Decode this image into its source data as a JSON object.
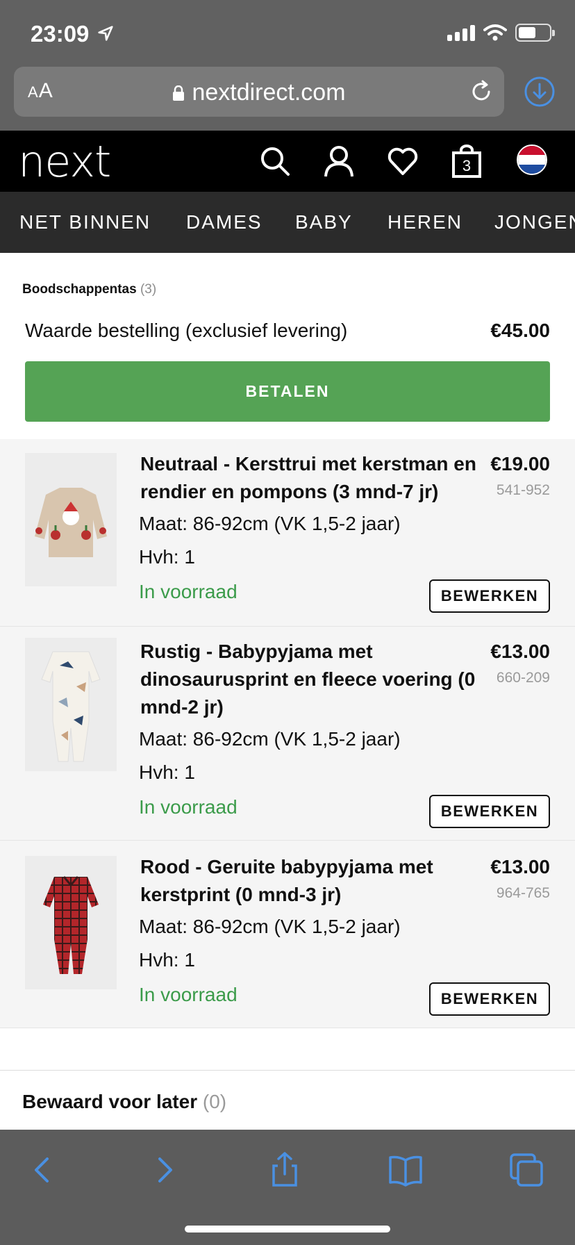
{
  "status_bar": {
    "time": "23:09"
  },
  "browser": {
    "text_size_label_small": "A",
    "text_size_label_large": "A",
    "url": "nextdirect.com"
  },
  "site": {
    "logo": "next",
    "bag_count": "3",
    "nav": [
      "NET BINNEN",
      "DAMES",
      "BABY",
      "HEREN",
      "JONGEN"
    ]
  },
  "bag": {
    "title": "Boodschappentas",
    "count": "(3)",
    "order_label": "Waarde bestelling (exclusief levering)",
    "order_value": "€45.00",
    "pay_label": "BETALEN"
  },
  "items": [
    {
      "name": "Neutraal - Kersttrui met kerstman en rendier en pompons (3 mnd-7 jr)",
      "price": "€19.00",
      "code": "541-952",
      "size": "Maat: 86-92cm (VK 1,5-2 jaar)",
      "qty": "Hvh: 1",
      "stock": "In voorraad",
      "edit": "BEWERKEN"
    },
    {
      "name": "Rustig - Babypyjama met dinosaurusprint en fleece voering (0 mnd-2 jr)",
      "price": "€13.00",
      "code": "660-209",
      "size": "Maat: 86-92cm (VK 1,5-2 jaar)",
      "qty": "Hvh: 1",
      "stock": "In voorraad",
      "edit": "BEWERKEN"
    },
    {
      "name": "Rood - Geruite babypyjama met kerstprint (0 mnd-3 jr)",
      "price": "€13.00",
      "code": "964-765",
      "size": "Maat: 86-92cm (VK 1,5-2 jaar)",
      "qty": "Hvh: 1",
      "stock": "In voorraad",
      "edit": "BEWERKEN"
    }
  ],
  "saved": {
    "title": "Bewaard voor later",
    "count": "(0)"
  },
  "colors": {
    "pay_green": "#55a355",
    "stock_green": "#3b9b4a",
    "safari_blue": "#4a90e2"
  },
  "icons": [
    "location-arrow-icon",
    "signal-icon",
    "wifi-icon",
    "battery-icon",
    "lock-icon",
    "reload-icon",
    "download-icon",
    "search-icon",
    "account-icon",
    "heart-icon",
    "bag-icon",
    "flag-nl-icon",
    "back-icon",
    "forward-icon",
    "share-icon",
    "bookmarks-icon",
    "tabs-icon"
  ]
}
